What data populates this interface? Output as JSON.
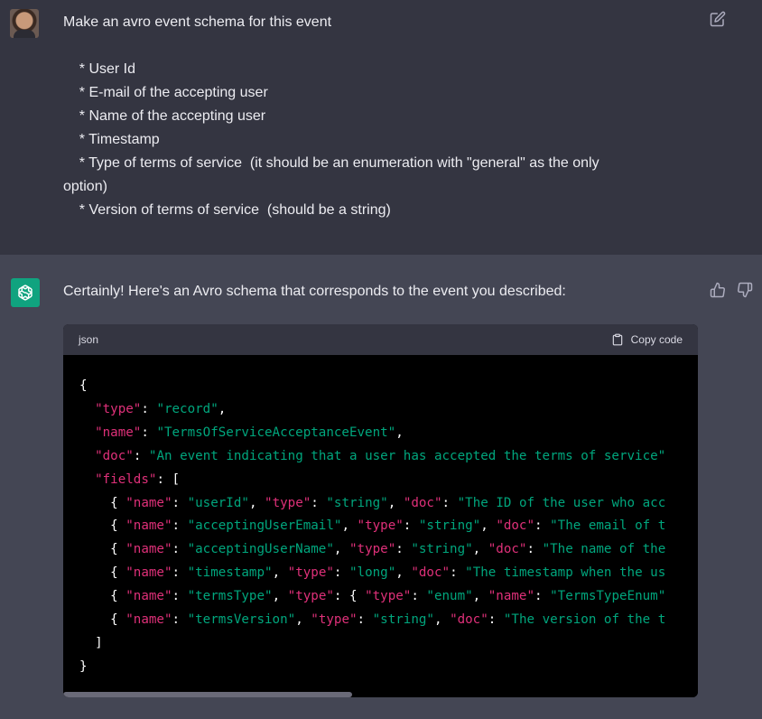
{
  "user_message": {
    "lines": [
      "Make an avro event schema for this event",
      "",
      "    * User Id",
      "    * E-mail of the accepting user",
      "    * Name of the accepting user",
      "    * Timestamp",
      "    * Type of terms of service  (it should be an enumeration with \"general\" as the only",
      "option)",
      "    * Version of terms of service  (should be a string)"
    ]
  },
  "assistant_message": {
    "intro": "Certainly! Here's an Avro schema that corresponds to the event you described:",
    "code_language": "json",
    "copy_label": "Copy code",
    "code_lines": [
      "{",
      "  \"type\": \"record\",",
      "  \"name\": \"TermsOfServiceAcceptanceEvent\",",
      "  \"doc\": \"An event indicating that a user has accepted the terms of service\"",
      "  \"fields\": [",
      "    { \"name\": \"userId\", \"type\": \"string\", \"doc\": \"The ID of the user who acc",
      "    { \"name\": \"acceptingUserEmail\", \"type\": \"string\", \"doc\": \"The email of t",
      "    { \"name\": \"acceptingUserName\", \"type\": \"string\", \"doc\": \"The name of the",
      "    { \"name\": \"timestamp\", \"type\": \"long\", \"doc\": \"The timestamp when the us",
      "    { \"name\": \"termsType\", \"type\": { \"type\": \"enum\", \"name\": \"TermsTypeEnum\"",
      "    { \"name\": \"termsVersion\", \"type\": \"string\", \"doc\": \"The version of the t",
      "  ]",
      "}"
    ]
  },
  "icons": {
    "edit": "edit-icon",
    "thumbs_up": "thumbs-up-icon",
    "thumbs_down": "thumbs-down-icon",
    "copy": "clipboard-icon",
    "assistant_logo": "openai-logo-icon"
  },
  "colors": {
    "user_bg": "#343541",
    "assistant_bg": "#444654",
    "code_bg": "#000000",
    "code_key": "#df3079",
    "code_string": "#00a67d",
    "logo_bg": "#10a37f"
  }
}
